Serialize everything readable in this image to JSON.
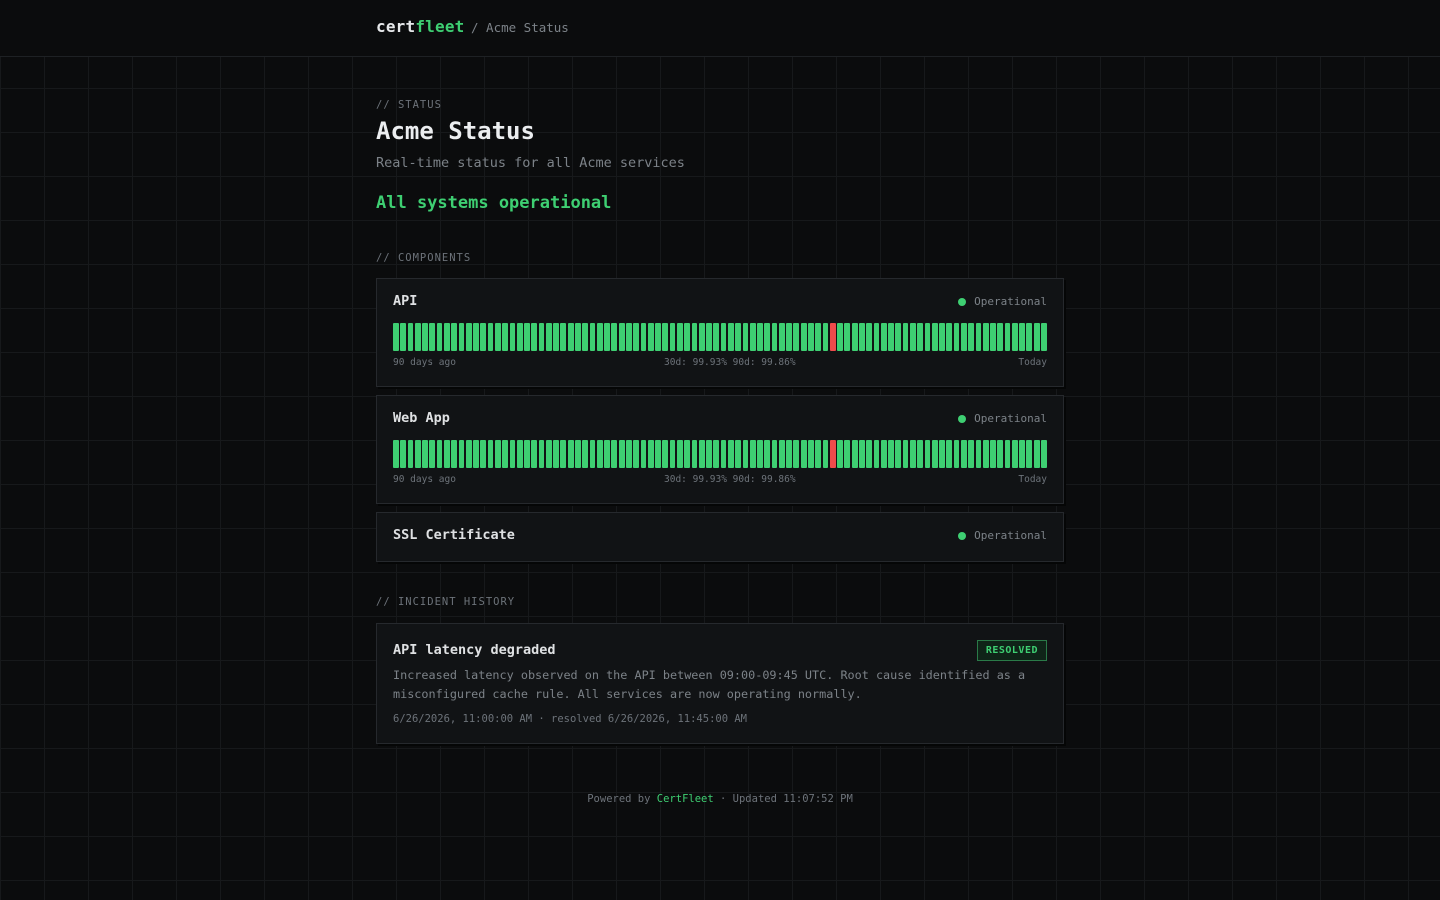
{
  "header": {
    "brand_prefix": "cert",
    "brand_accent": "fleet",
    "breadcrumb": "/ Acme Status"
  },
  "status_section": {
    "kicker": "// STATUS",
    "title": "Acme Status",
    "subtitle": "Real-time status for all Acme services",
    "overall": "All systems operational"
  },
  "components_section": {
    "kicker": "// COMPONENTS",
    "items": [
      {
        "name": "API",
        "status": "Operational",
        "uptime_days": 90,
        "incident_day_index": 60,
        "footer_left": "90 days ago",
        "uptime_30d": "30d: 99.93%",
        "uptime_90d": "90d: 99.86%",
        "footer_right": "Today"
      },
      {
        "name": "Web App",
        "status": "Operational",
        "uptime_days": 90,
        "incident_day_index": 60,
        "footer_left": "90 days ago",
        "uptime_30d": "30d: 99.93%",
        "uptime_90d": "90d: 99.86%",
        "footer_right": "Today"
      },
      {
        "name": "SSL Certificate",
        "status": "Operational"
      }
    ]
  },
  "incidents_section": {
    "kicker": "// INCIDENT HISTORY",
    "items": [
      {
        "title": "API latency degraded",
        "badge": "RESOLVED",
        "body": "Increased latency observed on the API between 09:00-09:45 UTC. Root cause identified as a misconfigured cache rule. All services are now operating normally.",
        "meta": "6/26/2026, 11:00:00 AM · resolved 6/26/2026, 11:45:00 AM"
      }
    ]
  },
  "footer": {
    "prefix": "Powered by ",
    "link": "CertFleet",
    "suffix": " · Updated 11:07:52 PM"
  },
  "colors": {
    "accent": "#3ecf72",
    "bad": "#ef4b4b",
    "background": "#0b0c0d",
    "card": "#111315"
  }
}
